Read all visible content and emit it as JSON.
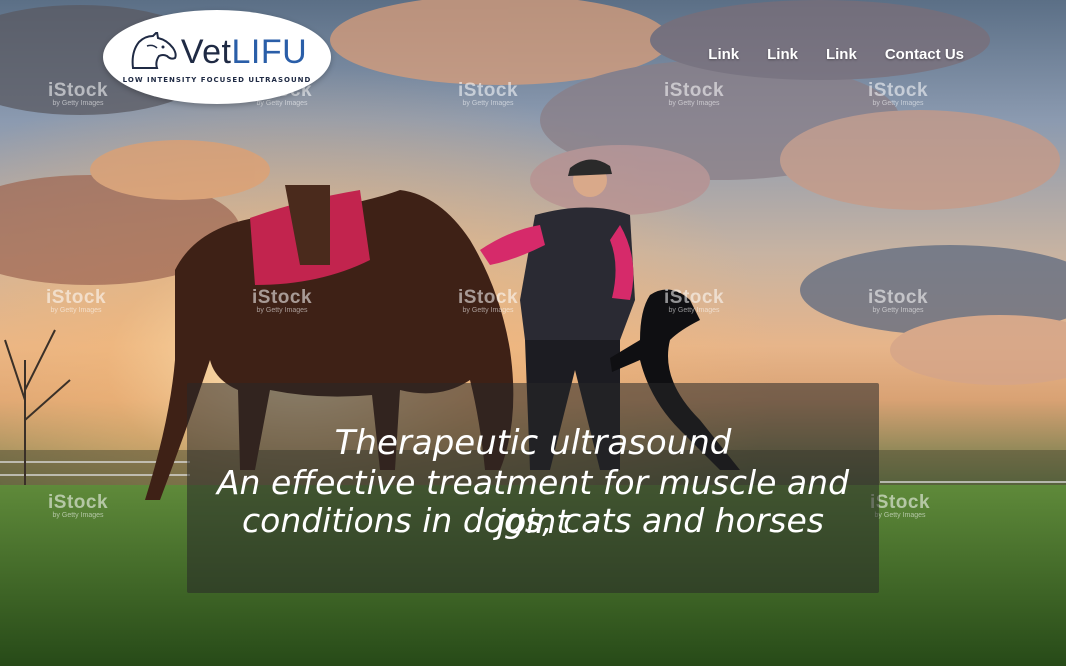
{
  "brand": {
    "name_part1": "Vet",
    "name_part2": "LIFU",
    "tagline": "LOW INTENSITY FOCUSED ULTRASOUND",
    "logo_icon": "horse-head-icon"
  },
  "nav": {
    "items": [
      {
        "label": "Link"
      },
      {
        "label": "Link"
      },
      {
        "label": "Link"
      },
      {
        "label": "Contact Us"
      }
    ]
  },
  "hero": {
    "line1": "Therapeutic ultrasound",
    "line2": "An effective treatment for muscle and joint",
    "line3": "conditions in dogs, cats and horses"
  },
  "watermark": {
    "text": "iStock",
    "subtext": "by Getty Images"
  },
  "colors": {
    "nav_text": "#ffffff",
    "logo_navy": "#1f2a44",
    "logo_blue": "#2a5ea8",
    "caption_bg": "rgba(40,40,40,0.55)"
  }
}
